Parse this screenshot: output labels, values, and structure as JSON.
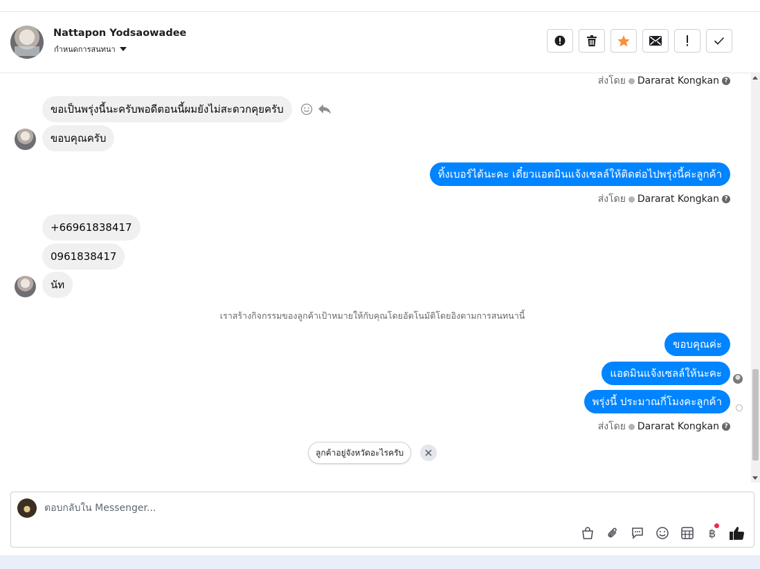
{
  "header": {
    "contact_name": "Nattapon Yodsaowadee",
    "assign_label": "กำหนดการสนทนา",
    "toolbar": [
      {
        "name": "spam",
        "icon": "alert-circle-icon"
      },
      {
        "name": "delete",
        "icon": "trash-icon"
      },
      {
        "name": "star",
        "icon": "star-icon",
        "color": "#f7923b"
      },
      {
        "name": "mark-unread",
        "icon": "envelope-icon"
      },
      {
        "name": "follow-up",
        "icon": "exclamation-icon"
      },
      {
        "name": "done",
        "icon": "checkmark-icon"
      }
    ]
  },
  "sent_by_prefix": "ส่งโดย",
  "agent_name": "Dararat Kongkan",
  "messages": {
    "in_1": "ขอเป็นพรุ่งนี้นะครับพอดีตอนนี้ผมยังไม่สะดวกคุยครับ",
    "in_2": "ขอบคุณครับ",
    "out_1": "ทิ้งเบอร์ได้นะคะ เดี๋ยวแอดมินแจ้งเซลล์ให้ติดต่อไปพรุ่งนี้ค่ะลูกค้า",
    "in_3": "+66961838417",
    "in_4": "0961838417",
    "in_5": "นัท",
    "system_note": "เราสร้างกิจกรรมของลูกค้าเป้าหมายให้กับคุณโดยอัตโนมัติโดยอิงตามการสนทนานี้",
    "out_2": "ขอบคุณค่ะ",
    "out_3": "แอดมินแจ้งเซลล์ให้นะคะ",
    "out_4": "พรุ่งนี้ ประมาณกี่โมงคะลูกค้า"
  },
  "suggested_reply": "ลูกค้าอยู่จังหวัดอะไรครับ",
  "composer": {
    "placeholder": "ตอบกลับใน Messenger...",
    "tools": [
      "shopping-bag-icon",
      "paperclip-icon",
      "saved-reply-icon",
      "emoji-icon",
      "table-icon",
      "baht-icon",
      "thumbs-up-icon"
    ],
    "baht_symbol": "฿",
    "accent_color": "#0084ff"
  }
}
